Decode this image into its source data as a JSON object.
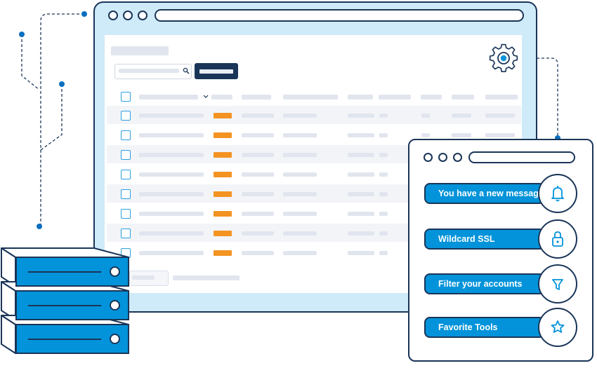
{
  "features": [
    {
      "label": "You have a new message",
      "icon": "bell-icon"
    },
    {
      "label": "Wildcard SSL Certificates",
      "icon": "lock-icon"
    },
    {
      "label": "Filter your accounts",
      "icon": "filter-icon"
    },
    {
      "label": "Favorite Tools",
      "icon": "star-icon"
    }
  ],
  "colors": {
    "outline": "#1a3558",
    "accent": "#0393da",
    "status_tag": "#f39322",
    "window_fill": "#cfeaf8"
  }
}
